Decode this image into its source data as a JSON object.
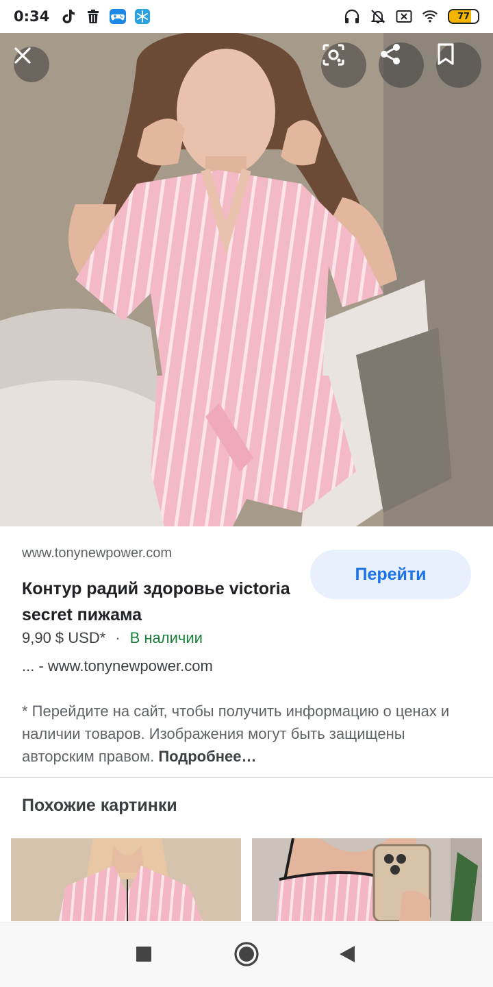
{
  "status_bar": {
    "time": "0:34",
    "battery_percent": "77",
    "icons": [
      "tiktok-icon",
      "trash-icon",
      "gamepad-icon",
      "snowflake-icon",
      "headphones-icon",
      "mute-icon",
      "sim-off-icon",
      "wifi-icon",
      "battery-icon"
    ]
  },
  "viewer": {
    "actions": [
      "close-icon",
      "lens-search-icon",
      "share-icon",
      "bookmark-icon"
    ]
  },
  "result": {
    "source": "www.tonynewpower.com",
    "go_label": "Перейти",
    "title": "Контур радий здоровье victoria secret пижама",
    "price": "9,90 $ USD*",
    "dot": "·",
    "stock": "В наличии",
    "site": "... - www.tonynewpower.com",
    "disclaimer": "* Перейдите на сайт, чтобы получить информацию о ценах и наличии товаров. Изображения могут быть защищены авторским правом.",
    "more": "Подробнее…"
  },
  "similar": {
    "title": "Похожие картинки"
  },
  "colors": {
    "accent": "#1a73e8",
    "go_bg": "#e8f0fe",
    "stock_green": "#188038",
    "battery": "#f5b400"
  }
}
